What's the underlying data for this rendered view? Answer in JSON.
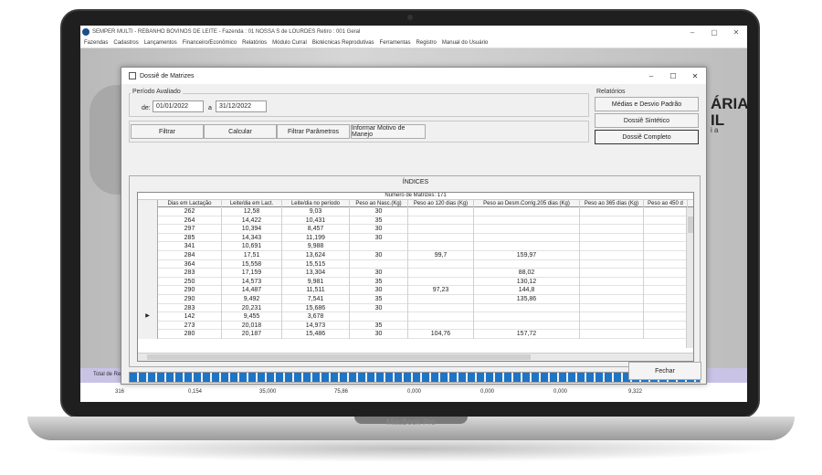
{
  "laptop": {
    "brand": "MacBook Pro"
  },
  "app": {
    "title": "SEMPER MULTI - REBANHO BOVINOS DE LEITE - Fazenda : 01 NOSSA S de LOURDES   Retiro : 001 Geral",
    "window_controls": [
      "–",
      "▢",
      "✕"
    ],
    "menu": [
      "Fazendas",
      "Cadastros",
      "Lançamentos",
      "Financeiro/Econômico",
      "Relatórios",
      "Módulo Curral",
      "Biotécnicas Reprodutivas",
      "Ferramentas",
      "Registro",
      "Manual do Usuário"
    ],
    "bg_logo_line1": "ÁRIA",
    "bg_logo_line2": "IL",
    "bg_logo_line3": "i a",
    "totals_label": "Total de Reb",
    "totals": [
      "316",
      "0,154",
      "35,000",
      "75,86",
      "0,000",
      "0,000",
      "0,000",
      "9,322"
    ]
  },
  "dialog": {
    "title": "Dossiê de Matrizes",
    "window_controls": [
      "–",
      "☐",
      "✕"
    ],
    "periodo_label": "Período Avaliado",
    "de_label": "de:",
    "de_value": "01/01/2022",
    "a_label": "a",
    "a_value": "31/12/2022",
    "buttons": {
      "filtrar": "Filtrar",
      "calcular": "Calcular",
      "filtrar_parametros": "Filtrar Parâmetros",
      "informar_motivo": "Informar Motivo de Manejo",
      "fechar": "Fechar"
    },
    "relatorios_label": "Relatórios",
    "relatorios": {
      "medias": "Médias e Desvio Padrão",
      "sintetico": "Dossiê Sintético",
      "completo": "Dossiê Completo"
    },
    "indices_title": "ÍNDICES",
    "grid": {
      "caption": "Número de Matrizes: 171",
      "columns": [
        "Dias em Lactação",
        "Leite/dia em Lact.",
        "Leite/dia no período",
        "Peso ao Nasc.(Kg)",
        "Peso ao 120 dias (Kg)",
        "Peso ao Desm.Corrig.205 dias (Kg)",
        "Peso ao 365 dias (Kg)",
        "Peso ao 450 d"
      ],
      "rows": [
        [
          "262",
          "12,58",
          "9,03",
          "30",
          "",
          "",
          "",
          ""
        ],
        [
          "264",
          "14,422",
          "10,431",
          "35",
          "",
          "",
          "",
          ""
        ],
        [
          "297",
          "10,394",
          "8,457",
          "30",
          "",
          "",
          "",
          ""
        ],
        [
          "285",
          "14,343",
          "11,199",
          "30",
          "",
          "",
          "",
          ""
        ],
        [
          "341",
          "10,691",
          "9,988",
          "",
          "",
          "",
          "",
          ""
        ],
        [
          "284",
          "17,51",
          "13,624",
          "30",
          "99,7",
          "159,97",
          "",
          ""
        ],
        [
          "364",
          "15,558",
          "15,515",
          "",
          "",
          "",
          "",
          ""
        ],
        [
          "283",
          "17,159",
          "13,304",
          "30",
          "",
          "88,02",
          "",
          ""
        ],
        [
          "250",
          "14,573",
          "9,981",
          "35",
          "",
          "130,12",
          "",
          ""
        ],
        [
          "290",
          "14,487",
          "11,511",
          "30",
          "97,23",
          "144,8",
          "",
          ""
        ],
        [
          "290",
          "9,492",
          "7,541",
          "35",
          "",
          "135,86",
          "",
          ""
        ],
        [
          "283",
          "20,231",
          "15,686",
          "30",
          "",
          "",
          "",
          ""
        ],
        [
          "142",
          "9,455",
          "3,678",
          "",
          "",
          "",
          "",
          ""
        ],
        [
          "273",
          "20,018",
          "14,973",
          "35",
          "",
          "",
          "",
          ""
        ],
        [
          "280",
          "20,187",
          "15,486",
          "30",
          "104,76",
          "157,72",
          "",
          ""
        ]
      ],
      "current_row_indicator": "▶",
      "current_row": 12
    }
  }
}
